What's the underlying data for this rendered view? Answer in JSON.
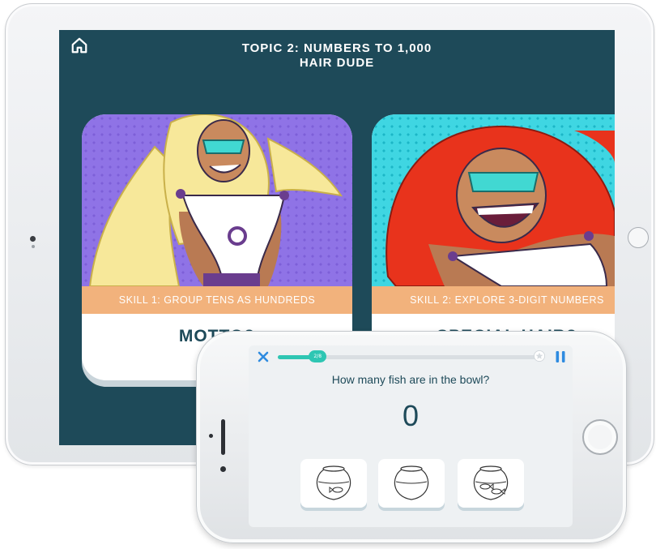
{
  "tablet": {
    "topic_title": "TOPIC 2: NUMBERS TO 1,000",
    "subtitle": "HAIR DUDE",
    "cards": [
      {
        "skill_label": "SKILL 1: GROUP TENS AS HUNDREDS",
        "name": "MOTTO?",
        "hair_color": "#f7e89a"
      },
      {
        "skill_label": "SKILL 2: EXPLORE 3-DIGIT NUMBERS",
        "name": "SPECIAL HAIR?",
        "hair_color": "#e8331c"
      }
    ]
  },
  "phone": {
    "progress_label": "2/8",
    "progress_fraction": 0.25,
    "question": "How many fish are in the bowl?",
    "answer": "0",
    "choices": [
      {
        "name": "fishbowl-with-one-fish"
      },
      {
        "name": "empty-fishbowl"
      },
      {
        "name": "fishbowl-with-two-fish"
      }
    ]
  },
  "colors": {
    "screen_bg": "#1e4a59",
    "skill_bar": "#f2b27c",
    "progress": "#2ec6b3",
    "close_icon": "#2e8be0"
  }
}
